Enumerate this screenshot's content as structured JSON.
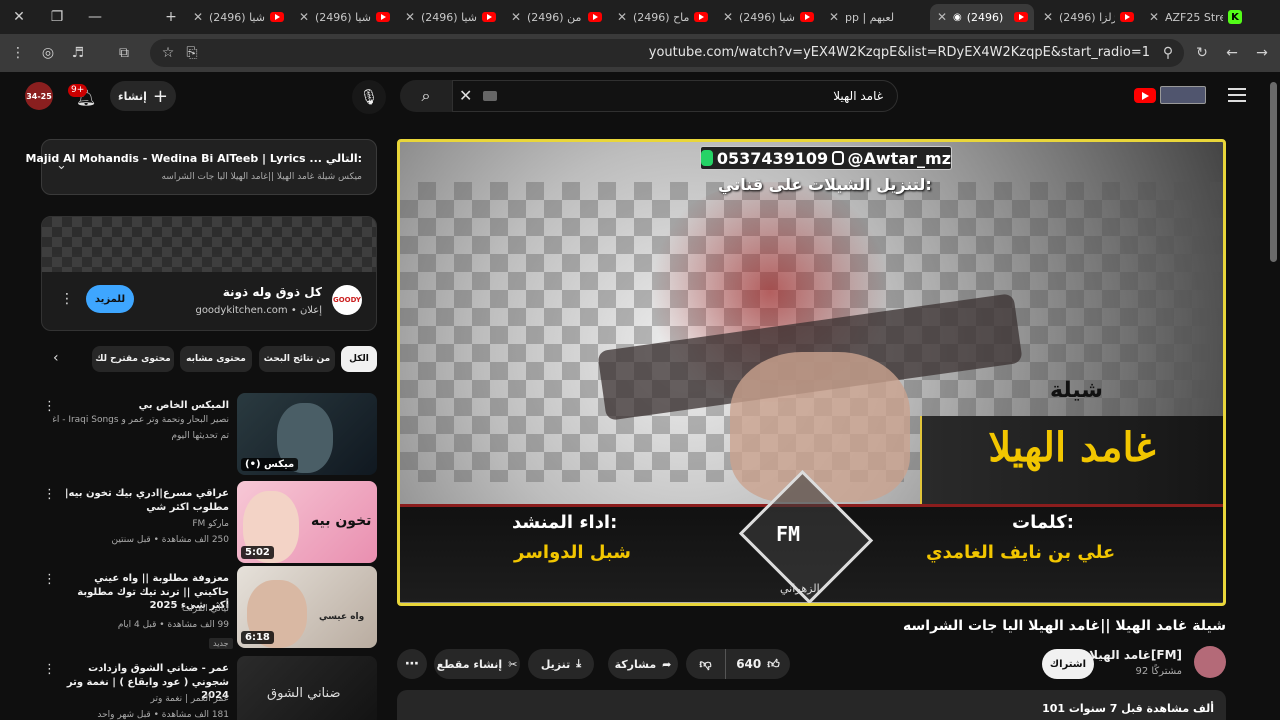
{
  "browser": {
    "window_controls": {
      "close": "✕",
      "restore": "❐",
      "minimize": "—",
      "new_tab": "+"
    },
    "tabs": [
      {
        "label": "(2496) شيا",
        "icon": "youtube-icon"
      },
      {
        "label": "(2496) شيا",
        "icon": "youtube-icon"
      },
      {
        "label": "(2496) شيا",
        "icon": "youtube-icon"
      },
      {
        "label": "(2496) من",
        "icon": "youtube-icon"
      },
      {
        "label": "(2496) ماح",
        "icon": "youtube-icon"
      },
      {
        "label": "(2496) شيا",
        "icon": "youtube-icon"
      },
      {
        "label": "pp | لعبهم",
        "icon": "sports-icon"
      },
      {
        "label": "(2496)",
        "icon": "audio-playing-icon",
        "active": true
      },
      {
        "label": "(2496) زلزا",
        "icon": "youtube-icon"
      },
      {
        "label": "AZF25 Stre",
        "icon": "kick-icon"
      }
    ],
    "url": "youtube.com/watch?v=yEX4W2KzqpE&list=RDyEX4W2KzqpE&start_radio=1"
  },
  "masthead": {
    "avatar_text": "34-25",
    "notification_count": "9+",
    "create_label": "إنشاء",
    "search_value": "غامد الهيلا"
  },
  "video": {
    "overlay": {
      "contact": "0537439109",
      "handle": "@Awtar_mz",
      "download_note": "لتنزيل الشيلات على قناتي:",
      "type_word": "شيلة",
      "big_title": "غامد الهيلا",
      "lyrics_label": "كلمات:",
      "lyrics_name": "علي بن نايف الغامدي",
      "performer_label": "اداء المنشد:",
      "performer_name": "شبل الدواسر",
      "logo_text": "FM",
      "logo_name": "الزهراني"
    },
    "title": "شيلة غامد الهيلا ||غامد الهيلا اليا جات الشراسه",
    "channel_name": "غامد الهيلا[FM]",
    "subscribers": "92 مشتركًا",
    "subscribe_label": "اشتراك",
    "likes": "640",
    "share_label": "مشاركة",
    "download_label": "تنزيل",
    "clip_label": "إنشاء مقطع",
    "views_meta": "101 ألف مشاهدة  قبل 7 سنوات"
  },
  "playlist": {
    "next_label": "التالي:",
    "next_title": "Majid Al Mohandis - Wedina Bi AlTeeb | Lyrics ...",
    "subtitle": "ميكس شيلة غامد الهيلا ||غامد الهيلا اليا جات الشراسه"
  },
  "ad": {
    "title": "كل ذوق وله ذونة",
    "sponsored": "إعلان",
    "domain": "goodykitchen.com",
    "button": "للمزيد",
    "logo_text": "GOODY"
  },
  "chips": [
    "الكل",
    "من نتائج البحث",
    "محتوى مشابه",
    "محتوى مقترح لك"
  ],
  "recommendations": [
    {
      "title": "الميكس الخاص بي",
      "line1": "نصير البحار ونحمة وتر عمر و Iraqi Songs - اغاني ع...",
      "line2": "تم تحديثها اليوم",
      "duration": "(•) ميكس"
    },
    {
      "title": "عراقي مسرع|ادري بيك تخون بيه| مطلوب اكثر شي",
      "line1": "ماركو FM",
      "line2": "250 ألف مشاهدة • قبل سنتين",
      "duration": "5:02",
      "thumb_text": "تخون بيه"
    },
    {
      "title": "معزوفة مطلوبة || واه عيني حاكيني || ترند تيك توك مطلوبة أكثر شيء 2025",
      "line1": "ليالي الفرات",
      "line2": "99 ألف مشاهدة • قبل 4 أيام",
      "badge": "جديد",
      "duration": "6:18",
      "thumb_text": "واه عيسي"
    },
    {
      "title": "عمر - ضناني الشوق وازدادت شجوني ( عود وايقاع ) | نغمة وتر 2024",
      "line1": "عمر العمر | نغمة وتر",
      "line2": "181 ألف مشاهدة • قبل شهر واحد",
      "thumb_text": "ضناني الشوق"
    }
  ],
  "colors": {
    "background": "#0f0f0f",
    "accent_red": "#ff0000",
    "ad_button": "#3ea6ff",
    "player_border": "#e9d63a",
    "title_yellow": "#f2c600"
  }
}
